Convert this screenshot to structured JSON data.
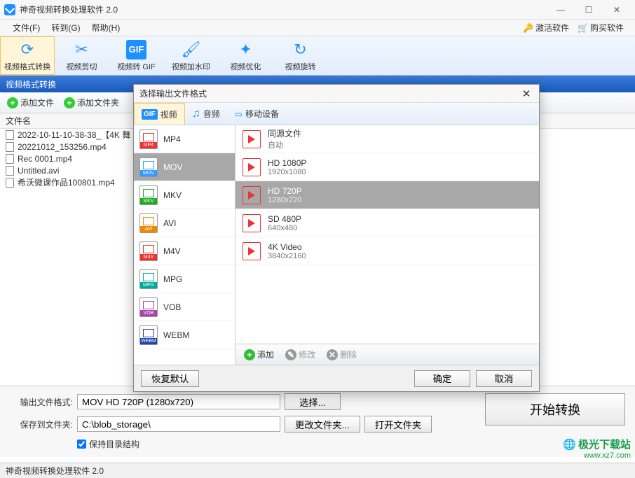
{
  "app": {
    "title": "神奇视频转换处理软件 2.0",
    "status": "神奇视频转换处理软件 2.0"
  },
  "menus": {
    "file": "文件(F)",
    "goto": "转到(G)",
    "help": "帮助(H)",
    "activate": "激活软件",
    "buy": "购买软件"
  },
  "toolbar": [
    {
      "label": "视频格式转换",
      "active": true
    },
    {
      "label": "视频剪切"
    },
    {
      "label": "视频转 GIF"
    },
    {
      "label": "视频加水印"
    },
    {
      "label": "视频优化"
    },
    {
      "label": "视频旋转"
    }
  ],
  "section": {
    "title": "视频格式转换"
  },
  "addbar": {
    "addfile": "添加文件",
    "addfolder": "添加文件夹"
  },
  "filecol": "文件名",
  "files": [
    "2022-10-11-10-38-38_【4K 舞",
    "20221012_153256.mp4",
    "Rec 0001.mp4",
    "Untitled.avi",
    "希沃微课作品100801.mp4"
  ],
  "form": {
    "output_fmt_label": "输出文件格式:",
    "output_fmt_value": "MOV HD 720P (1280x720)",
    "select_btn": "选择...",
    "save_to_label": "保存到文件夹:",
    "save_to_value": "C:\\blob_storage\\",
    "change_btn": "更改文件夹...",
    "open_btn": "打开文件夹",
    "keep_dir": "保持目录结构",
    "start_btn": "开始转换"
  },
  "dialog": {
    "title": "选择输出文件格式",
    "tabs": {
      "video": "视频",
      "audio": "音频",
      "mobile": "移动设备"
    },
    "formats": [
      {
        "name": "MP4",
        "color": "c-red"
      },
      {
        "name": "MOV",
        "color": "c-blue",
        "selected": true
      },
      {
        "name": "MKV",
        "color": "c-green"
      },
      {
        "name": "AVI",
        "color": "c-orange"
      },
      {
        "name": "M4V",
        "color": "c-red"
      },
      {
        "name": "MPG",
        "color": "c-teal"
      },
      {
        "name": "VOB",
        "color": "c-purple"
      },
      {
        "name": "WEBM",
        "color": "c-dblue"
      }
    ],
    "resolutions": [
      {
        "title": "同源文件",
        "sub": "自动"
      },
      {
        "title": "HD 1080P",
        "sub": "1920x1080"
      },
      {
        "title": "HD 720P",
        "sub": "1280x720",
        "selected": true
      },
      {
        "title": "SD 480P",
        "sub": "640x480"
      },
      {
        "title": "4K Video",
        "sub": "3840x2160"
      }
    ],
    "actions": {
      "add": "添加",
      "edit": "修改",
      "delete": "删除"
    },
    "footer": {
      "restore": "恢复默认",
      "ok": "确定",
      "cancel": "取消"
    }
  },
  "watermark": {
    "l1": "极光下载站",
    "l2": "www.xz7.com"
  }
}
